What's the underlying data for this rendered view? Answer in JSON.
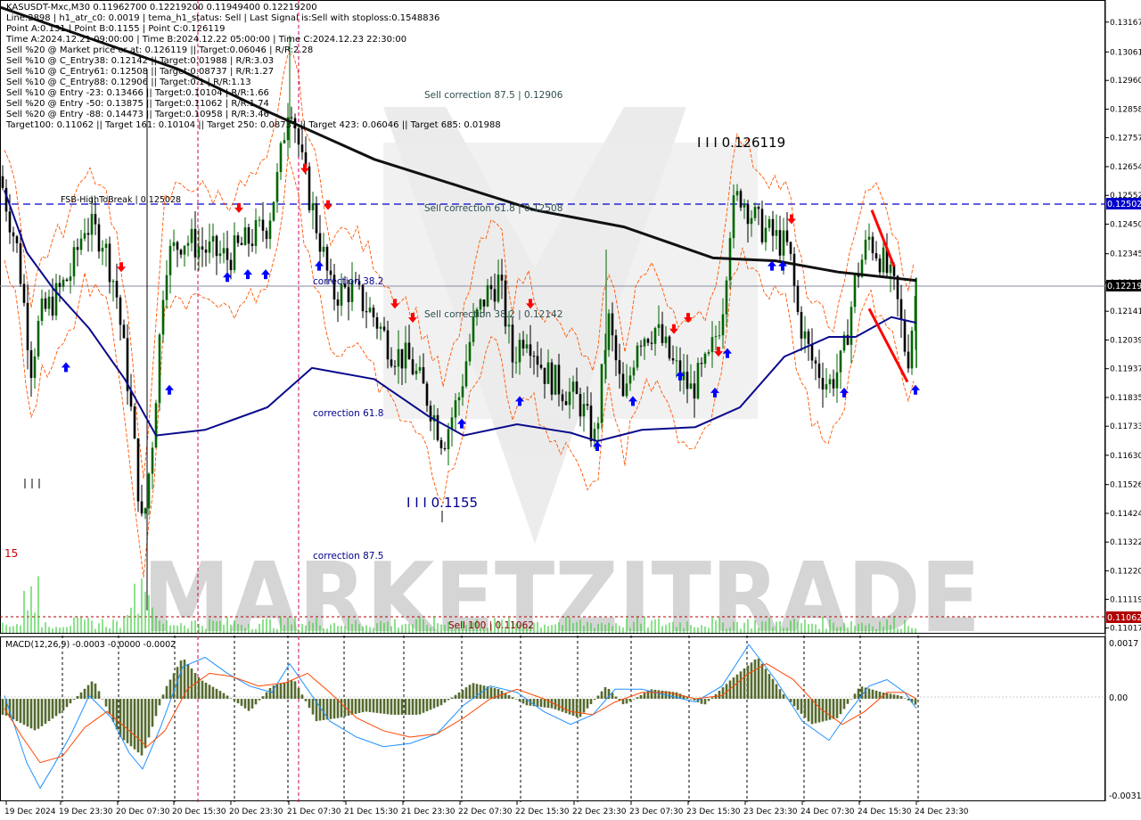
{
  "header": {
    "lines": [
      "KASUSDT-Mxc,M30  0.11962700 0.12219200 0.11949400 0.12219200",
      "Line:2898 | h1_atr_c0: 0.0019 | tema_h1_status: Sell | Last Signal is:Sell with stoploss:0.1548836",
      "Point A:0.131 | Point B:0.1155 | Point C:0.126119",
      "Time A:2024.12.21 09:00:00 | Time B:2024.12.22 05:00:00 | Time C:2024.12.23 22:30:00",
      "Sell %20 @ Market price or at: 0.126119 || Target:0.06046 | R/R:2.28",
      "Sell %10 @ C_Entry38: 0.12142 || Target:0.01988 | R/R:3.03",
      "Sell %10 @ C_Entry61: 0.12508 || Target:0.08737 | R/R:1.27",
      "Sell %10 @ C_Entry88: 0.12906 || Target:0.1 | R/R:1.13",
      "Sell %10 @ Entry -23: 0.13466 || Target:0.10104 | R/R:1.66",
      "Sell %20 @ Entry -50: 0.13875 || Target:0.11062 | R/R:1.74",
      "Sell %20 @ Entry -88: 0.14473 || Target:0.10958 | R/R:3.46",
      "Target100: 0.11062 || Target 161: 0.10104 || Target 250: 0.08737 || Target 423: 0.06046 || Target 685: 0.01988"
    ]
  },
  "annotations": {
    "sell_correction_875": "Sell correction 87.5 | 0.12906",
    "sell_correction_618": "Sell correction 61.8 | 0.12508",
    "sell_correction_382": "Sell correction 38.2 | 0.12142",
    "sell_100": "Sell 100 | 0.11062",
    "fsb": "FSB-HighToBreak | 0.125028",
    "point_c": "I I I 0.126119",
    "point_b": "I I I 0.1155",
    "correction_382": "correction 38.2",
    "correction_618": "correction 61.8",
    "correction_875": "correction 87.5",
    "left_15": "15",
    "watermark": "MARKETZITRADE"
  },
  "price_axis": {
    "ticks": [
      "0.13167",
      "0.13061",
      "0.12960",
      "0.12858",
      "0.12757",
      "0.12654",
      "0.12552",
      "0.12450",
      "0.12345",
      "0.12243",
      "0.12141",
      "0.12039",
      "0.11937",
      "0.11835",
      "0.11733",
      "0.11630",
      "0.11526",
      "0.11424",
      "0.11322",
      "0.11220",
      "0.11119",
      "0.11017"
    ],
    "current_label": "0.12219",
    "fsb_label": "0.12502",
    "sell100_label": "0.11062"
  },
  "macd": {
    "title": "MACD(12,26,9) -0.0003 -0.0000 -0.0002",
    "ticks": [
      "0.0017",
      "0.00",
      "-0.0031"
    ]
  },
  "time_axis": {
    "labels": [
      "19 Dec 2024",
      "19 Dec 23:30",
      "20 Dec 07:30",
      "20 Dec 15:30",
      "20 Dec 23:30",
      "21 Dec 07:30",
      "21 Dec 15:30",
      "21 Dec 23:30",
      "22 Dec 07:30",
      "22 Dec 15:30",
      "22 Dec 23:30",
      "23 Dec 07:30",
      "23 Dec 15:30",
      "23 Dec 23:30",
      "24 Dec 07:30",
      "24 Dec 15:30",
      "24 Dec 23:30"
    ]
  },
  "colors": {
    "bull_candle": "#006400",
    "bear_candle": "#000000",
    "ma_long": "#111111",
    "ma_mid": "#0a0a8c",
    "envelope": "#ff5500",
    "fsb_line": "#0000cc",
    "sell100_line": "#b00000",
    "macd_hist": "#556b2f",
    "macd_line": "#1e90ff",
    "signal_line": "#ff4500",
    "volume": "#33cc33",
    "arrow_up": "#0000ff",
    "arrow_down": "#ff0000",
    "pattern_line": "#ff0000"
  },
  "chart_data": {
    "type": "candlestick",
    "symbol": "KASUSDT-Mxc",
    "timeframe": "M30",
    "last": {
      "open": 0.119627,
      "high": 0.122192,
      "low": 0.119494,
      "close": 0.122192
    },
    "points": {
      "A": 0.131,
      "B": 0.1155,
      "C": 0.126119
    },
    "levels": [
      0.12906,
      0.12508,
      0.125028,
      0.12142,
      0.11062
    ],
    "ylim": [
      0.11,
      0.1322
    ],
    "long_ma_path": [
      [
        0,
        0.1322
      ],
      [
        200,
        0.13
      ],
      [
        300,
        0.1285
      ],
      [
        420,
        0.1268
      ],
      [
        520,
        0.1258
      ],
      [
        600,
        0.125
      ],
      [
        700,
        0.1244
      ],
      [
        800,
        0.1233
      ],
      [
        870,
        0.1232
      ],
      [
        940,
        0.1228
      ],
      [
        1028,
        0.1225
      ]
    ],
    "mid_ma_path": [
      [
        5,
        0.1257
      ],
      [
        30,
        0.1235
      ],
      [
        60,
        0.1222
      ],
      [
        100,
        0.1208
      ],
      [
        140,
        0.119
      ],
      [
        175,
        0.117
      ],
      [
        230,
        0.1172
      ],
      [
        300,
        0.118
      ],
      [
        350,
        0.1194
      ],
      [
        420,
        0.119
      ],
      [
        480,
        0.1177
      ],
      [
        520,
        0.117
      ],
      [
        580,
        0.1174
      ],
      [
        640,
        0.1171
      ],
      [
        670,
        0.1168
      ],
      [
        720,
        0.1172
      ],
      [
        780,
        0.1173
      ],
      [
        830,
        0.118
      ],
      [
        880,
        0.1198
      ],
      [
        930,
        0.1205
      ],
      [
        960,
        0.1205
      ],
      [
        1000,
        0.1212
      ],
      [
        1028,
        0.121
      ]
    ],
    "up_arrows": [
      [
        74,
        0.1196
      ],
      [
        190,
        0.1188
      ],
      [
        255,
        0.1228
      ],
      [
        278,
        0.1229
      ],
      [
        298,
        0.1229
      ],
      [
        358,
        0.1232
      ],
      [
        518,
        0.1176
      ],
      [
        583,
        0.1184
      ],
      [
        670,
        0.1168
      ],
      [
        710,
        0.1184
      ],
      [
        763,
        0.1193
      ],
      [
        802,
        0.1187
      ],
      [
        816,
        0.1201
      ],
      [
        866,
        0.1232
      ],
      [
        878,
        0.1232
      ],
      [
        947,
        0.1187
      ],
      [
        1027,
        0.1188
      ]
    ],
    "down_arrows": [
      [
        136,
        0.1228
      ],
      [
        268,
        0.1249
      ],
      [
        342,
        0.1263
      ],
      [
        368,
        0.125
      ],
      [
        443,
        0.1215
      ],
      [
        463,
        0.121
      ],
      [
        595,
        0.1215
      ],
      [
        756,
        0.1206
      ],
      [
        772,
        0.121
      ],
      [
        806,
        0.1198
      ],
      [
        888,
        0.1245
      ]
    ],
    "pattern_lines": [
      [
        [
          978,
          0.125
        ],
        [
          1003,
          0.123
        ]
      ],
      [
        [
          975,
          0.1215
        ],
        [
          1018,
          0.1189
        ]
      ]
    ],
    "macd": {
      "range": [
        -0.0031,
        0.0019
      ],
      "hist_anchor": [
        [
          5,
          -0.0005
        ],
        [
          40,
          -0.001
        ],
        [
          70,
          -0.0004
        ],
        [
          105,
          0.0006
        ],
        [
          135,
          -0.0012
        ],
        [
          160,
          -0.0018
        ],
        [
          185,
          0.0003
        ],
        [
          205,
          0.0013
        ],
        [
          225,
          0.0006
        ],
        [
          250,
          0.0002
        ],
        [
          280,
          -0.0004
        ],
        [
          305,
          0.0004
        ],
        [
          330,
          0.0006
        ],
        [
          355,
          -0.0007
        ],
        [
          380,
          -0.0006
        ],
        [
          410,
          -0.0004
        ],
        [
          440,
          -0.0005
        ],
        [
          470,
          -0.0005
        ],
        [
          495,
          -0.0002
        ],
        [
          530,
          0.0005
        ],
        [
          560,
          0.0003
        ],
        [
          590,
          -0.0002
        ],
        [
          620,
          -0.0003
        ],
        [
          650,
          -0.0006
        ],
        [
          680,
          0.0004
        ],
        [
          700,
          -0.0002
        ],
        [
          730,
          0.0003
        ],
        [
          760,
          0.0002
        ],
        [
          790,
          -0.0002
        ],
        [
          820,
          0.0006
        ],
        [
          850,
          0.0013
        ],
        [
          880,
          0.0001
        ],
        [
          910,
          -0.0008
        ],
        [
          940,
          -0.0006
        ],
        [
          965,
          0.0004
        ],
        [
          990,
          0.0002
        ],
        [
          1010,
          0.0001
        ],
        [
          1028,
          -0.0002
        ]
      ],
      "macd_line": [
        [
          5,
          0.0001
        ],
        [
          30,
          -0.002
        ],
        [
          45,
          -0.0028
        ],
        [
          60,
          -0.0021
        ],
        [
          80,
          -0.0011
        ],
        [
          100,
          0.0001
        ],
        [
          125,
          -0.0006
        ],
        [
          145,
          -0.0017
        ],
        [
          160,
          -0.0022
        ],
        [
          180,
          -0.0009
        ],
        [
          205,
          0.001
        ],
        [
          230,
          0.0013
        ],
        [
          255,
          0.0008
        ],
        [
          280,
          0.0004
        ],
        [
          305,
          0.0002
        ],
        [
          325,
          0.0011
        ],
        [
          345,
          0.0003
        ],
        [
          370,
          -0.0007
        ],
        [
          400,
          -0.0012
        ],
        [
          430,
          -0.0015
        ],
        [
          460,
          -0.0014
        ],
        [
          490,
          -0.0011
        ],
        [
          520,
          -0.0002
        ],
        [
          550,
          0.0004
        ],
        [
          580,
          0.0002
        ],
        [
          610,
          -0.0004
        ],
        [
          640,
          -0.0008
        ],
        [
          665,
          -0.0005
        ],
        [
          690,
          0.0003
        ],
        [
          720,
          0.0003
        ],
        [
          750,
          0.0001
        ],
        [
          780,
          -0.0001
        ],
        [
          810,
          0.0004
        ],
        [
          840,
          0.0017
        ],
        [
          870,
          0.0006
        ],
        [
          900,
          -0.0007
        ],
        [
          930,
          -0.0013
        ],
        [
          950,
          -0.0005
        ],
        [
          975,
          0.0004
        ],
        [
          995,
          0.0006
        ],
        [
          1015,
          0.0002
        ],
        [
          1028,
          -0.0003
        ]
      ],
      "signal_line": [
        [
          5,
          -0.0003
        ],
        [
          25,
          -0.0012
        ],
        [
          45,
          -0.002
        ],
        [
          70,
          -0.0018
        ],
        [
          95,
          -0.0009
        ],
        [
          120,
          -0.0004
        ],
        [
          145,
          -0.001
        ],
        [
          165,
          -0.0015
        ],
        [
          185,
          -0.001
        ],
        [
          210,
          0.0003
        ],
        [
          235,
          0.0008
        ],
        [
          260,
          0.0007
        ],
        [
          290,
          0.0004
        ],
        [
          320,
          0.0005
        ],
        [
          345,
          0.0008
        ],
        [
          370,
          0.0002
        ],
        [
          400,
          -0.0006
        ],
        [
          430,
          -0.001
        ],
        [
          460,
          -0.0012
        ],
        [
          490,
          -0.0011
        ],
        [
          520,
          -0.0006
        ],
        [
          550,
          0.0
        ],
        [
          580,
          0.0003
        ],
        [
          610,
          0.0
        ],
        [
          640,
          -0.0004
        ],
        [
          665,
          -0.0005
        ],
        [
          690,
          -0.0001
        ],
        [
          720,
          0.0002
        ],
        [
          750,
          0.0002
        ],
        [
          780,
          0.0
        ],
        [
          810,
          0.0001
        ],
        [
          840,
          0.0008
        ],
        [
          860,
          0.0011
        ],
        [
          890,
          0.0006
        ],
        [
          920,
          -0.0003
        ],
        [
          945,
          -0.0008
        ],
        [
          970,
          -0.0004
        ],
        [
          995,
          0.0002
        ],
        [
          1015,
          0.0002
        ],
        [
          1028,
          0.0
        ]
      ]
    }
  }
}
